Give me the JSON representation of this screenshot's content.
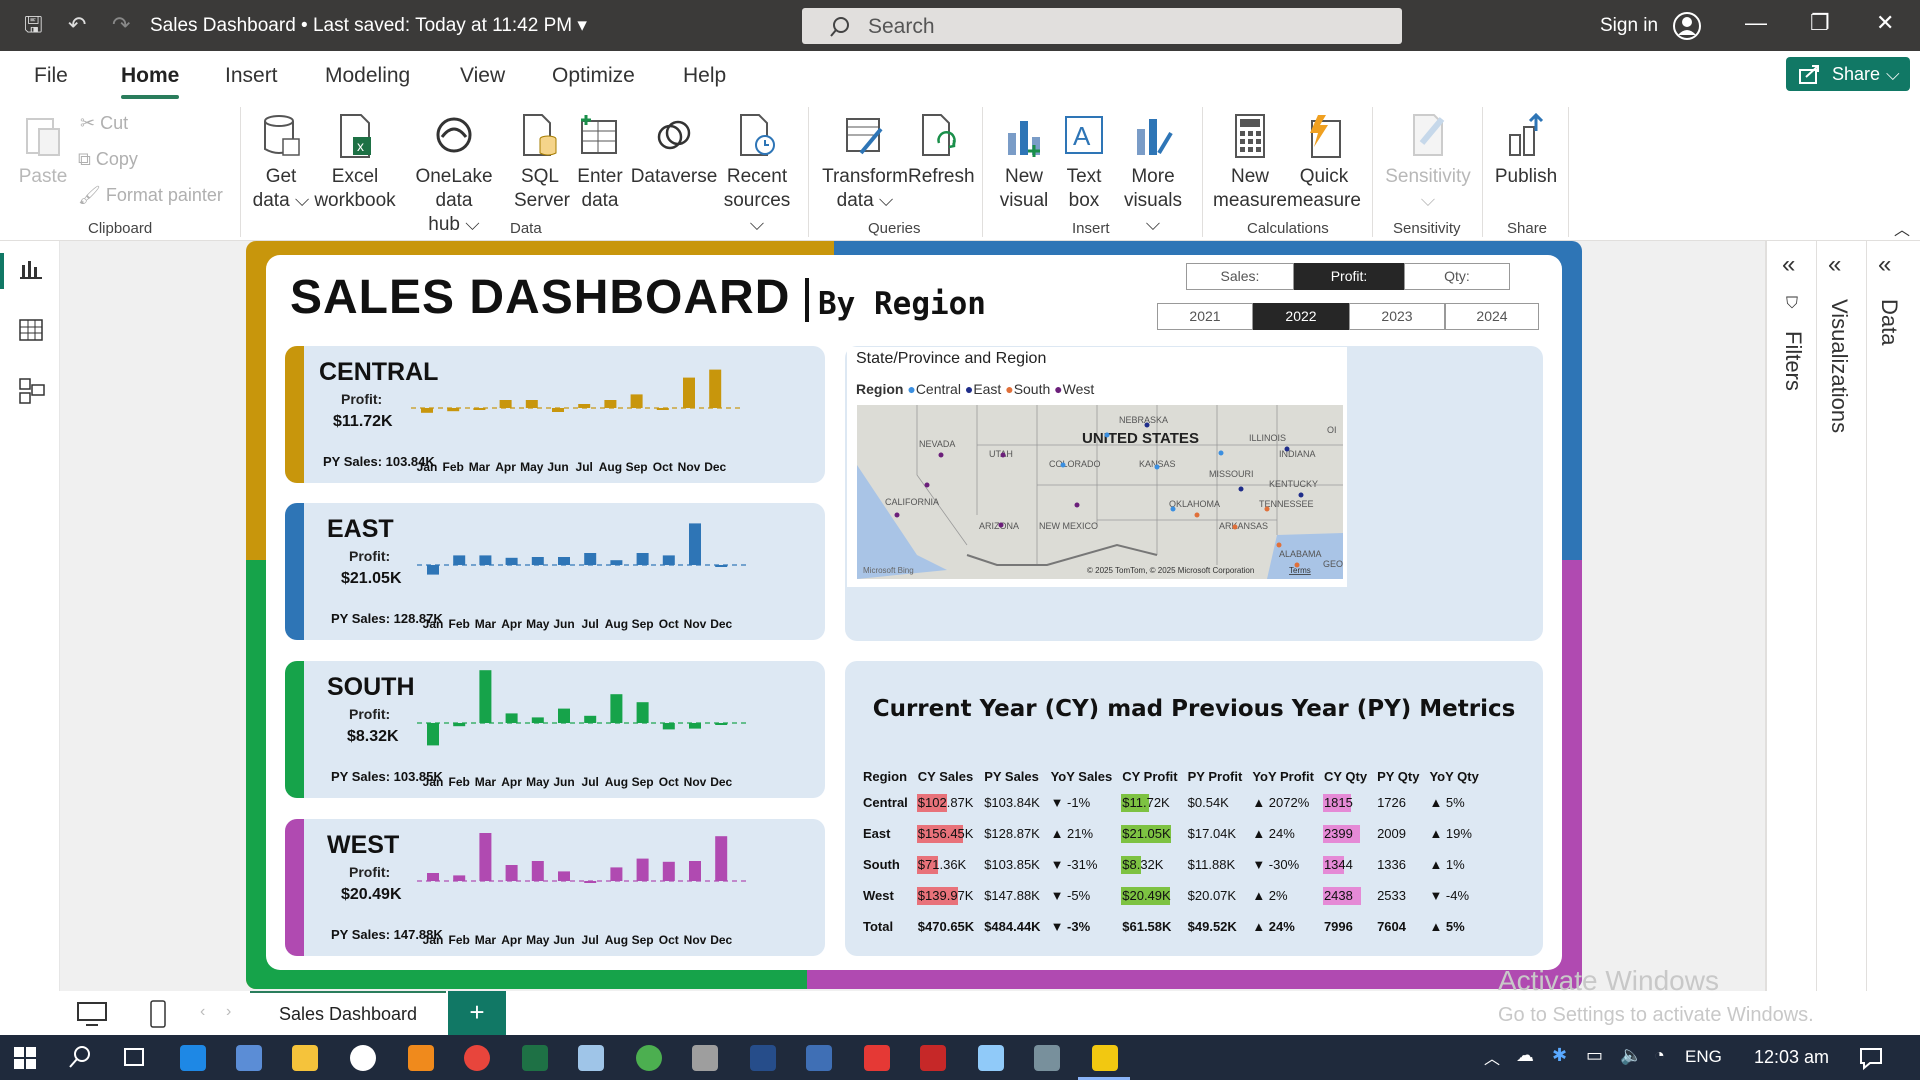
{
  "window": {
    "title": "Sales Dashboard • Last saved: Today at 11:42 PM",
    "search_placeholder": "Search",
    "sign_in": "Sign in"
  },
  "menu": [
    "File",
    "Home",
    "Insert",
    "Modeling",
    "View",
    "Optimize",
    "Help"
  ],
  "share_label": "Share",
  "ribbon": {
    "clipboard": {
      "paste": "Paste",
      "cut": "Cut",
      "copy": "Copy",
      "format_painter": "Format painter",
      "group": "Clipboard"
    },
    "data": {
      "get_data": [
        "Get",
        "data"
      ],
      "excel": [
        "Excel",
        "workbook"
      ],
      "onelake": [
        "OneLake data",
        "hub"
      ],
      "sql": [
        "SQL",
        "Server"
      ],
      "enter": [
        "Enter",
        "data"
      ],
      "dataverse": "Dataverse",
      "recent": [
        "Recent",
        "sources"
      ],
      "group": "Data"
    },
    "queries": {
      "transform": [
        "Transform",
        "data"
      ],
      "refresh": "Refresh",
      "group": "Queries"
    },
    "insert": {
      "new_visual": [
        "New",
        "visual"
      ],
      "text_box": [
        "Text",
        "box"
      ],
      "more_visuals": [
        "More",
        "visuals"
      ],
      "group": "Insert"
    },
    "calculations": {
      "new_measure": [
        "New",
        "measure"
      ],
      "quick_measure": [
        "Quick",
        "measure"
      ],
      "group": "Calculations"
    },
    "sensitivity": {
      "label": "Sensitivity",
      "group": "Sensitivity"
    },
    "share": {
      "publish": "Publish",
      "group": "Share"
    }
  },
  "panes": {
    "filters": "Filters",
    "visualizations": "Visualizations",
    "data": "Data"
  },
  "dashboard": {
    "title": "SALES DASHBOARD",
    "subtitle": "By Region",
    "metric_slicer": [
      "Sales:",
      "Profit:",
      "Qty:"
    ],
    "metric_selected": "Profit:",
    "year_slicer": [
      "2021",
      "2022",
      "2023",
      "2024"
    ],
    "year_selected": "2022",
    "profit_label": "Profit:",
    "months": [
      "Jan",
      "Feb",
      "Mar",
      "Apr",
      "May",
      "Jun",
      "Jul",
      "Aug",
      "Sep",
      "Oct",
      "Nov",
      "Dec"
    ],
    "regions": [
      {
        "name": "CENTRAL",
        "profit": "$11.72K",
        "py_sales": "PY Sales: 103.84K",
        "color": "#c8960c"
      },
      {
        "name": "EAST",
        "profit": "$21.05K",
        "py_sales": "PY Sales: 128.87K",
        "color": "#2e75b6"
      },
      {
        "name": "SOUTH",
        "profit": "$8.32K",
        "py_sales": "PY Sales: 103.85K",
        "color": "#16a34a"
      },
      {
        "name": "WEST",
        "profit": "$20.49K",
        "py_sales": "PY Sales: 147.88K",
        "color": "#b04ab1"
      }
    ],
    "map": {
      "title": "State/Province and Region",
      "legend_label": "Region",
      "legend": [
        {
          "name": "Central",
          "color": "#3b8fe0"
        },
        {
          "name": "East",
          "color": "#1f2d8a"
        },
        {
          "name": "South",
          "color": "#e0703a"
        },
        {
          "name": "West",
          "color": "#6b1f7a"
        }
      ],
      "country_label": "UNITED STATES",
      "state_labels": [
        "NEBRASKA",
        "NEVADA",
        "UTAH",
        "ILLINOIS",
        "INDIANA",
        "COLORADO",
        "KANSAS",
        "MISSOURI",
        "KENTUCKY",
        "CALIFORNIA",
        "OKLAHOMA",
        "TENNESSEE",
        "ARIZONA",
        "NEW MEXICO",
        "ARKANSAS",
        "ALABAMA",
        "OI",
        "GEOR"
      ],
      "attribution": "© 2025 TomTom, © 2025 Microsoft Corporation",
      "terms": "Terms",
      "bing": "Microsoft Bing"
    },
    "metrics": {
      "title": "Current Year (CY) mad Previous Year (PY) Metrics",
      "headers": [
        "Region",
        "CY Sales",
        "PY Sales",
        "YoY Sales",
        "CY Profit",
        "PY Profit",
        "YoY Profit",
        "CY Qty",
        "PY Qty",
        "YoY Qty"
      ],
      "rows": [
        [
          "Central",
          "$102.87K",
          "$103.84K",
          "▼ -1%",
          "$11.72K",
          "$0.54K",
          "▲ 2072%",
          "1815",
          "1726",
          "▲ 5%"
        ],
        [
          "East",
          "$156.45K",
          "$128.87K",
          "▲ 21%",
          "$21.05K",
          "$17.04K",
          "▲ 24%",
          "2399",
          "2009",
          "▲ 19%"
        ],
        [
          "South",
          "$71.36K",
          "$103.85K",
          "▼ -31%",
          "$8.32K",
          "$11.88K",
          "▼ -30%",
          "1344",
          "1336",
          "▲ 1%"
        ],
        [
          "West",
          "$139.97K",
          "$147.88K",
          "▼ -5%",
          "$20.49K",
          "$20.07K",
          "▲ 2%",
          "2438",
          "2533",
          "▼ -4%"
        ],
        [
          "Total",
          "$470.65K",
          "$484.44K",
          "▼ -3%",
          "$61.58K",
          "$49.52K",
          "▲ 24%",
          "7996",
          "7604",
          "▲ 5%"
        ]
      ],
      "cy_sales_bar_fraction": [
        0.66,
        1.0,
        0.46,
        0.89
      ],
      "cy_profit_bar_fraction": [
        0.56,
        1.0,
        0.4,
        0.97
      ],
      "cy_qty_bar_fraction": [
        0.74,
        0.98,
        0.55,
        1.0
      ],
      "bar_colors": {
        "sales": "#e8727a",
        "profit": "#7dc242",
        "qty": "#e58ad6"
      }
    }
  },
  "page_tab": "Sales Dashboard",
  "watermark": {
    "line1": "Activate Windows",
    "line2": "Go to Settings to activate Windows."
  },
  "taskbar": {
    "lang": "ENG",
    "time": "12:03 am"
  },
  "chart_data": [
    {
      "type": "bar",
      "title": "CENTRAL",
      "categories": [
        "Jan",
        "Feb",
        "Mar",
        "Apr",
        "May",
        "Jun",
        "Jul",
        "Aug",
        "Sep",
        "Oct",
        "Nov",
        "Dec"
      ],
      "values": [
        -0.3,
        -0.2,
        -0.05,
        0.5,
        0.5,
        -0.25,
        0.25,
        0.5,
        0.85,
        -0.1,
        1.9,
        2.4
      ],
      "reference_line": 0.0
    },
    {
      "type": "bar",
      "title": "EAST",
      "categories": [
        "Jan",
        "Feb",
        "Mar",
        "Apr",
        "May",
        "Jun",
        "Jul",
        "Aug",
        "Sep",
        "Oct",
        "Nov",
        "Dec"
      ],
      "values": [
        -0.6,
        0.6,
        0.6,
        0.45,
        0.5,
        0.5,
        0.75,
        0.3,
        0.75,
        0.6,
        2.6,
        -0.1
      ],
      "reference_line": 0.0
    },
    {
      "type": "bar",
      "title": "SOUTH",
      "categories": [
        "Jan",
        "Feb",
        "Mar",
        "Apr",
        "May",
        "Jun",
        "Jul",
        "Aug",
        "Sep",
        "Oct",
        "Nov",
        "Dec"
      ],
      "values": [
        -1.4,
        -0.2,
        3.3,
        0.6,
        0.35,
        0.9,
        0.45,
        1.8,
        1.3,
        -0.4,
        -0.35,
        -0.1
      ],
      "reference_line": 0.0
    },
    {
      "type": "bar",
      "title": "WEST",
      "categories": [
        "Jan",
        "Feb",
        "Mar",
        "Apr",
        "May",
        "Jun",
        "Jul",
        "Aug",
        "Sep",
        "Oct",
        "Nov",
        "Dec"
      ],
      "values": [
        0.5,
        0.35,
        3.0,
        1.0,
        1.25,
        0.6,
        -0.05,
        0.85,
        1.4,
        1.2,
        1.25,
        2.8
      ],
      "reference_line": 0.0
    }
  ]
}
